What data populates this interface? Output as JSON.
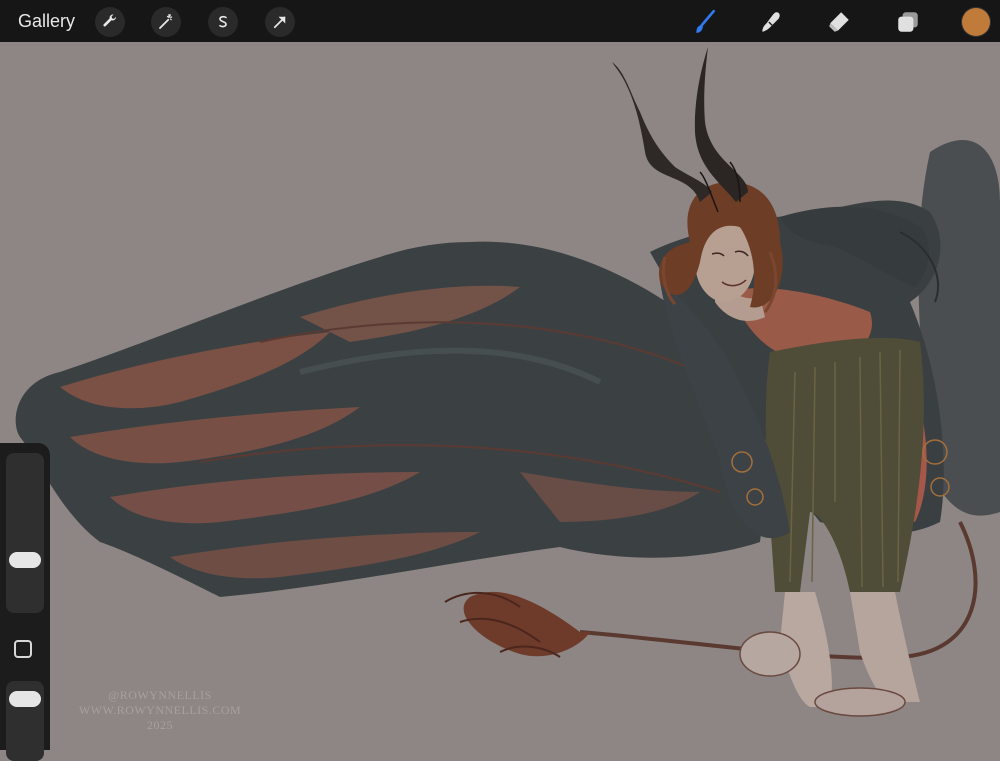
{
  "toolbar": {
    "gallery_label": "Gallery",
    "left_tools": [
      {
        "name": "actions",
        "icon": "wrench-icon"
      },
      {
        "name": "adjustments",
        "icon": "magic-wand-icon"
      },
      {
        "name": "selection",
        "icon": "selection-s-icon"
      },
      {
        "name": "transform",
        "icon": "arrow-cursor-icon"
      }
    ],
    "right_tools": [
      {
        "name": "brush",
        "icon": "brush-icon",
        "active": true
      },
      {
        "name": "smudge",
        "icon": "smudge-finger-icon",
        "active": false
      },
      {
        "name": "eraser",
        "icon": "eraser-icon",
        "active": false
      },
      {
        "name": "layers",
        "icon": "layers-icon",
        "active": false
      }
    ],
    "active_color": "#c07a3a",
    "active_tool_color": "#2f7bf2"
  },
  "sidebar": {
    "brush_size_level": 0.3,
    "opacity_level": 0.9
  },
  "watermark": {
    "handle": "@ROWYNNELLIS",
    "website": "WWW.ROWYNNELLIS.COM",
    "year": "2025"
  }
}
